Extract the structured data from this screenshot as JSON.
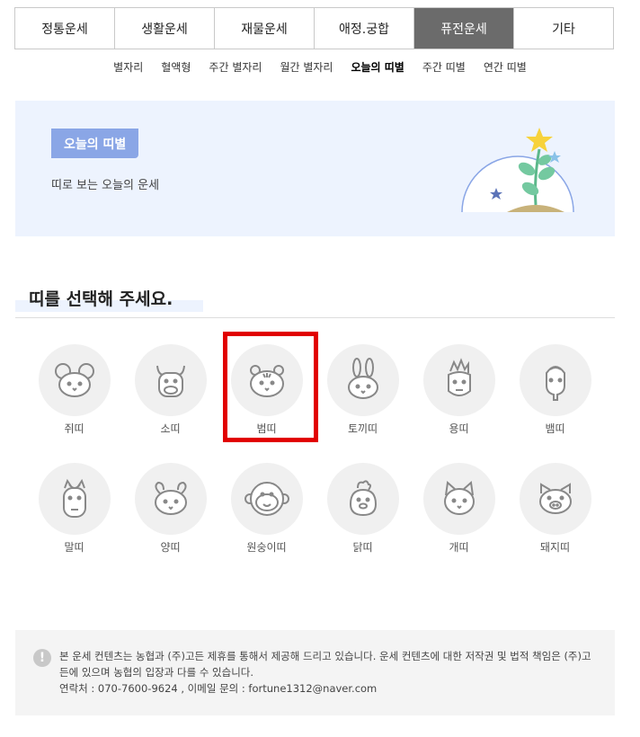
{
  "tabs": [
    {
      "label": "정통운세",
      "active": false
    },
    {
      "label": "생활운세",
      "active": false
    },
    {
      "label": "재물운세",
      "active": false
    },
    {
      "label": "애정.궁합",
      "active": false
    },
    {
      "label": "퓨전운세",
      "active": true
    },
    {
      "label": "기타",
      "active": false
    }
  ],
  "subnav": [
    {
      "label": "별자리",
      "active": false
    },
    {
      "label": "혈액형",
      "active": false
    },
    {
      "label": "주간 별자리",
      "active": false
    },
    {
      "label": "월간 별자리",
      "active": false
    },
    {
      "label": "오늘의 띠별",
      "active": true
    },
    {
      "label": "주간 띠별",
      "active": false
    },
    {
      "label": "연간 띠별",
      "active": false
    }
  ],
  "banner": {
    "badge": "오늘의 띠별",
    "description": "띠로 보는 오늘의 운세"
  },
  "heading": "띠를 선택해 주세요.",
  "zodiac": [
    {
      "label": "쥐띠",
      "icon": "rat-icon"
    },
    {
      "label": "소띠",
      "icon": "ox-icon"
    },
    {
      "label": "범띠",
      "icon": "tiger-icon"
    },
    {
      "label": "토끼띠",
      "icon": "rabbit-icon"
    },
    {
      "label": "용띠",
      "icon": "dragon-icon"
    },
    {
      "label": "뱀띠",
      "icon": "snake-icon"
    },
    {
      "label": "말띠",
      "icon": "horse-icon"
    },
    {
      "label": "양띠",
      "icon": "sheep-icon"
    },
    {
      "label": "원숭이띠",
      "icon": "monkey-icon"
    },
    {
      "label": "닭띠",
      "icon": "rooster-icon"
    },
    {
      "label": "개띠",
      "icon": "dog-icon"
    },
    {
      "label": "돼지띠",
      "icon": "pig-icon"
    }
  ],
  "notice": {
    "line1": "본 운세 컨텐츠는 농협과 (주)고든 제휴를 통해서 제공해 드리고 있습니다. 운세 컨텐츠에 대한 저작권 및 법적 책임은 (주)고든에 있으며 농협의 입장과 다를 수 있습니다.",
    "line2": "연락처 : 070-7600-9624 , 이메일 문의 : fortune1312@naver.com"
  },
  "colors": {
    "active_tab": "#6b6b6b",
    "banner_bg": "#edf3fe",
    "badge_bg": "#8aa6e6",
    "highlight": "#e10000"
  }
}
